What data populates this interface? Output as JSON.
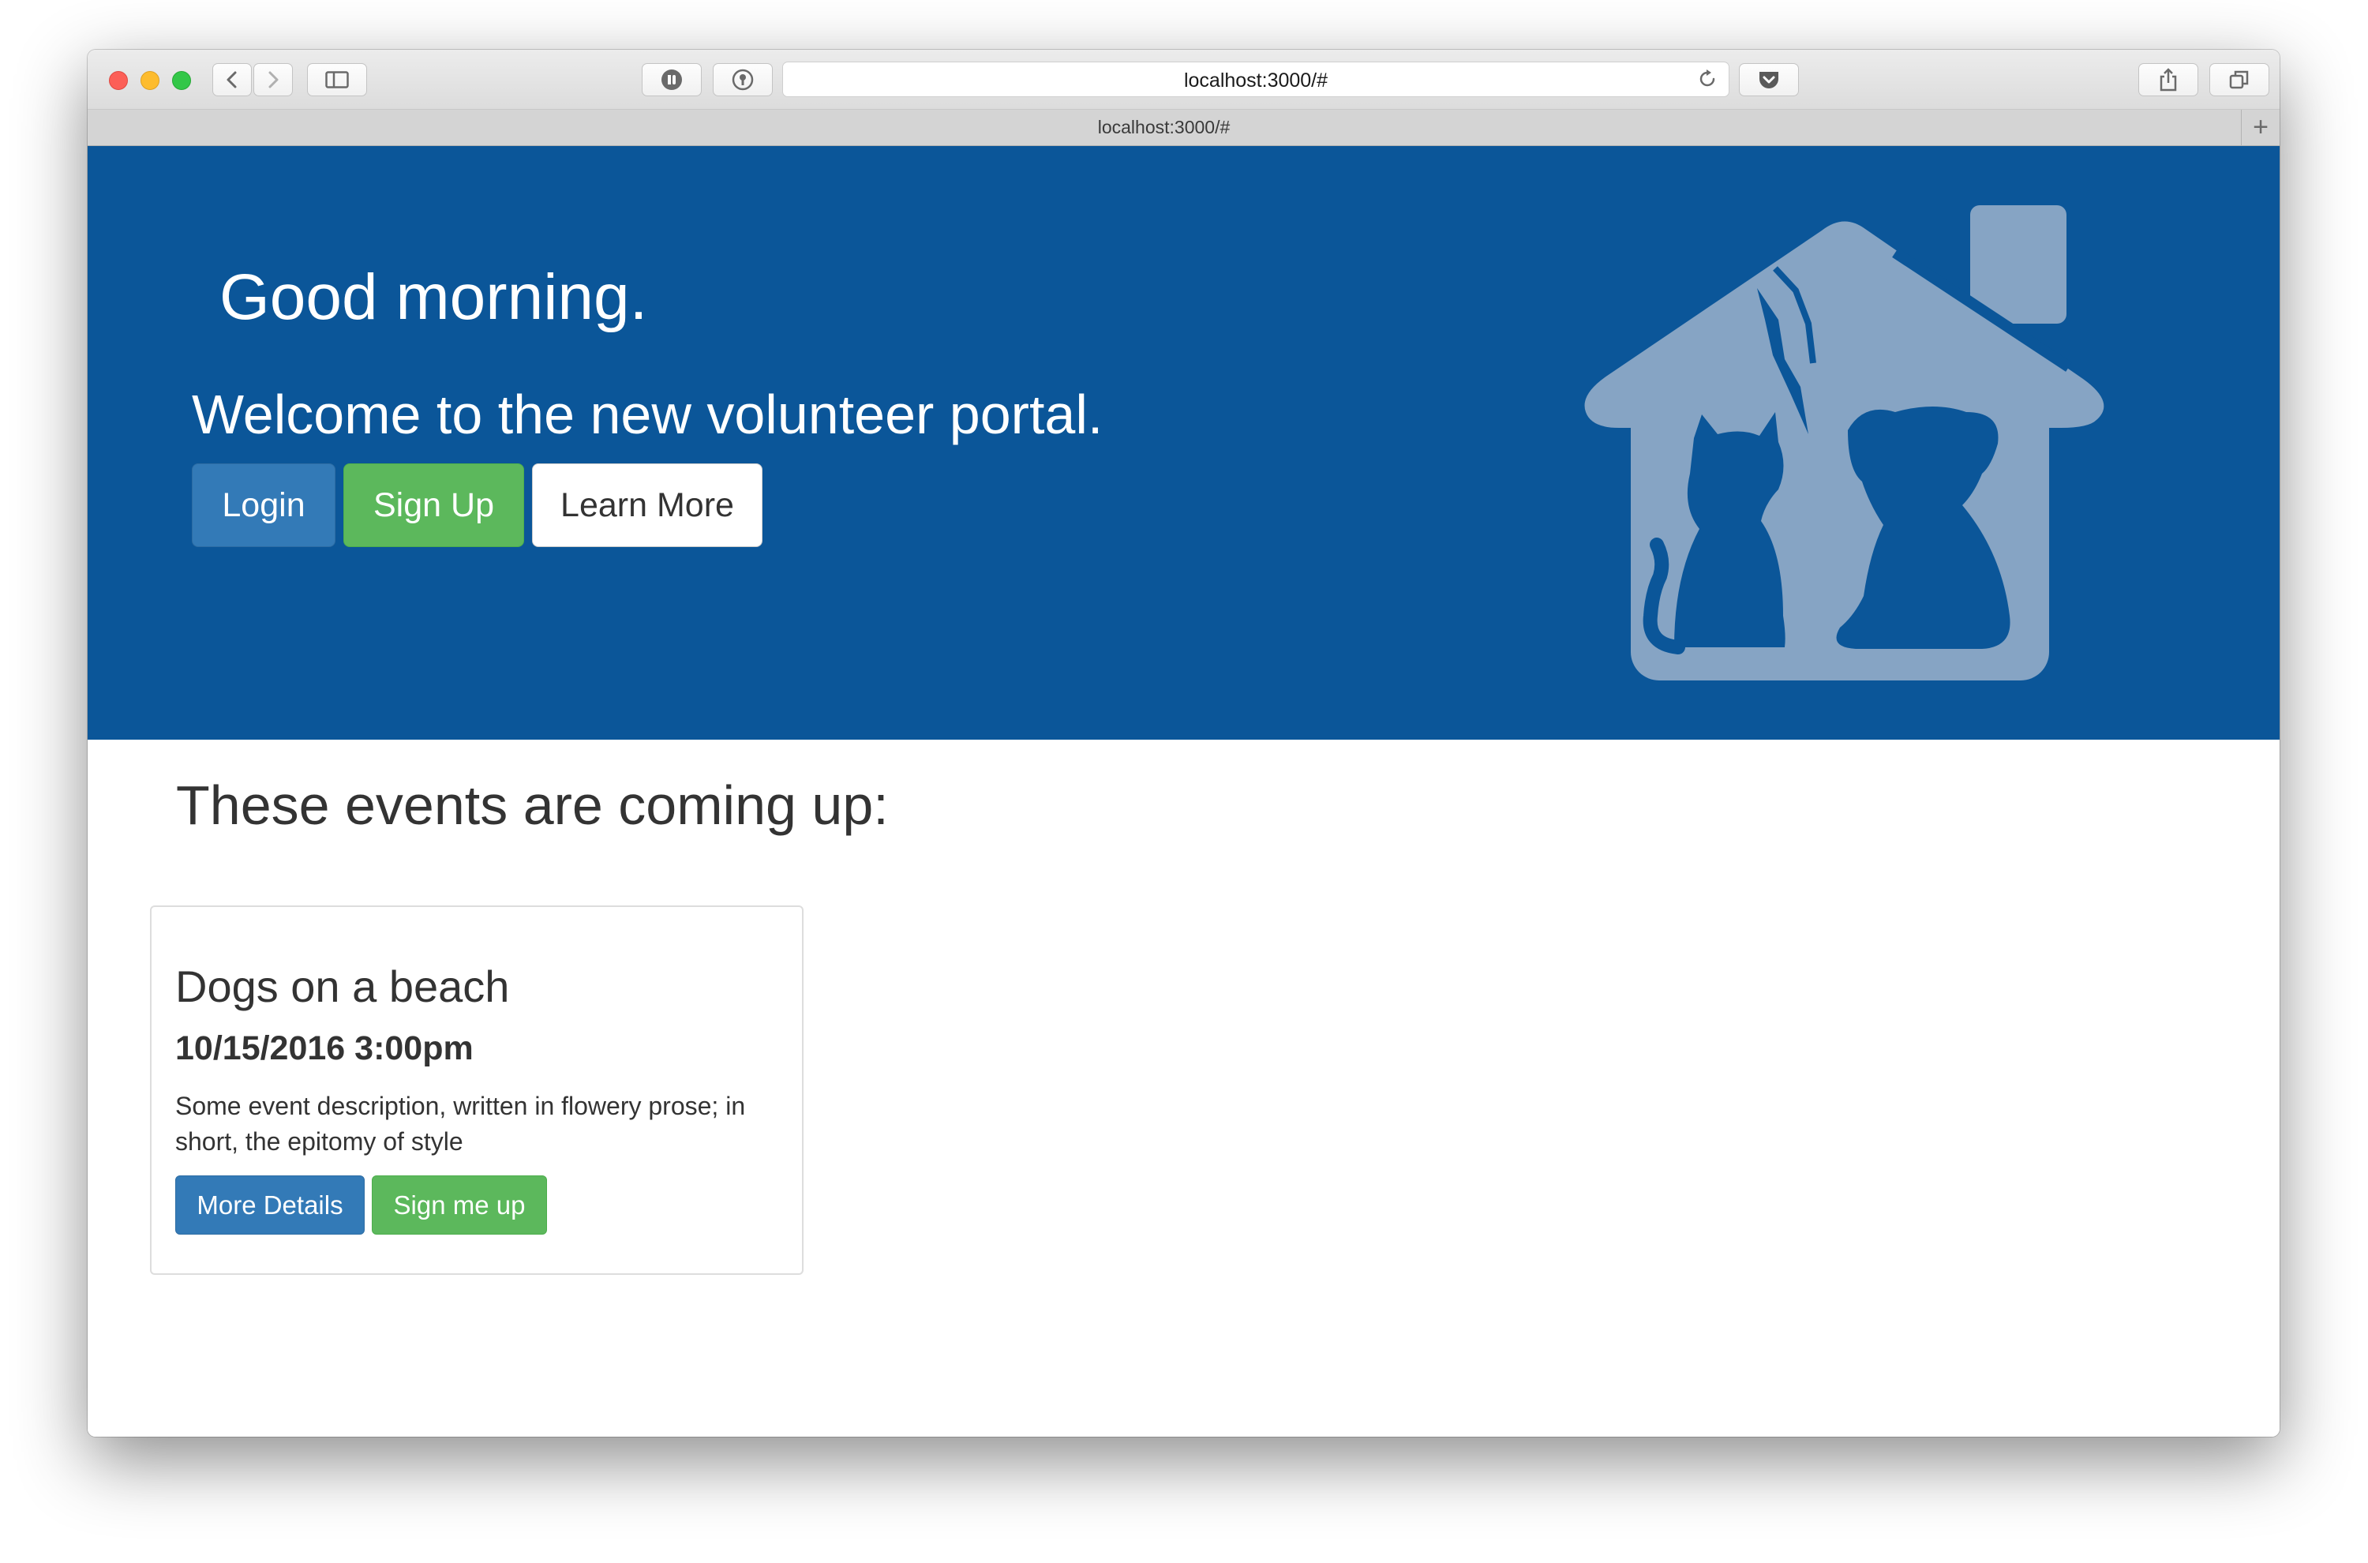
{
  "browser": {
    "address": "localhost:3000/#",
    "tab_title": "localhost:3000/#",
    "new_tab_glyph": "+",
    "icons": [
      "back-icon",
      "forward-icon",
      "sidebar-icon",
      "password-icon",
      "extension-icon",
      "reload-icon",
      "pocket-icon",
      "share-icon",
      "tabs-overview-icon"
    ]
  },
  "hero": {
    "greeting": "Good morning.",
    "welcome": "Welcome to the new volunteer portal.",
    "buttons": {
      "login": "Login",
      "signup": "Sign Up",
      "learn_more": "Learn More"
    },
    "logo_icon": "house-cat-dog-icon",
    "colors": {
      "background": "#0b5699",
      "logo": "#86a4c4",
      "primary": "#337ab7",
      "success": "#5cb85c"
    }
  },
  "events": {
    "heading": "These events are coming up:",
    "items": [
      {
        "title": "Dogs on a beach",
        "datetime": "10/15/2016 3:00pm",
        "description": "Some event description, written in flowery prose; in short, the epitomy of style",
        "details_label": "More Details",
        "signup_label": "Sign me up"
      }
    ]
  }
}
